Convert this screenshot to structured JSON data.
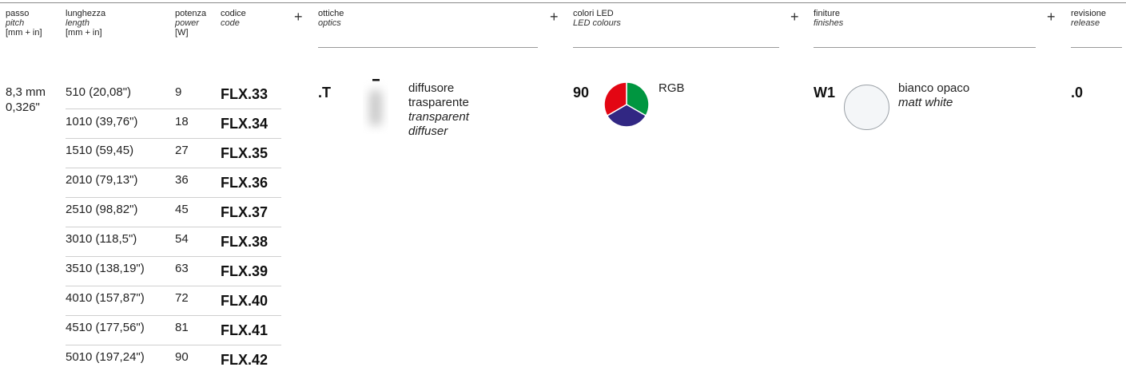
{
  "headers": {
    "pitch": {
      "it_label": "passo",
      "en_label": "pitch",
      "unit": "[mm + in]"
    },
    "length": {
      "it_label": "lunghezza",
      "en_label": "length",
      "unit": "[mm + in]"
    },
    "power": {
      "it_label": "potenza",
      "en_label": "power",
      "unit": "[W]"
    },
    "code": {
      "it_label": "codice",
      "en_label": "code"
    },
    "optics": {
      "it_label": "ottiche",
      "en_label": "optics"
    },
    "led": {
      "it_label": "colori LED",
      "en_label": "LED colours"
    },
    "finishes": {
      "it_label": "finiture",
      "en_label": "finishes"
    },
    "release": {
      "it_label": "revisione",
      "en_label": "release"
    }
  },
  "plus_symbol": "+",
  "pitch": {
    "mm": "8,3 mm",
    "in": "0,326\""
  },
  "rows": [
    {
      "length": "510 (20,08\")",
      "power": "9",
      "code": "FLX.33"
    },
    {
      "length": "1010 (39,76\")",
      "power": "18",
      "code": "FLX.34"
    },
    {
      "length": "1510 (59,45)",
      "power": "27",
      "code": "FLX.35"
    },
    {
      "length": "2010 (79,13\")",
      "power": "36",
      "code": "FLX.36"
    },
    {
      "length": "2510 (98,82\")",
      "power": "45",
      "code": "FLX.37"
    },
    {
      "length": "3010 (118,5\")",
      "power": "54",
      "code": "FLX.38"
    },
    {
      "length": "3510 (138,19\")",
      "power": "63",
      "code": "FLX.39"
    },
    {
      "length": "4010 (157,87\")",
      "power": "72",
      "code": "FLX.40"
    },
    {
      "length": "4510 (177,56\")",
      "power": "81",
      "code": "FLX.41"
    },
    {
      "length": "5010 (197,24\")",
      "power": "90",
      "code": "FLX.42"
    }
  ],
  "optics": {
    "code": ".T",
    "it_1": "diffusore",
    "it_2": "trasparente",
    "en_1": "transparent",
    "en_2": "diffuser"
  },
  "led": {
    "code": "90",
    "label": "RGB",
    "colors": {
      "red": "#e30613",
      "green": "#009640",
      "blue": "#312783"
    }
  },
  "finish": {
    "code": "W1",
    "it": "bianco opaco",
    "en": "matt white",
    "swatch": "#f4f6f8"
  },
  "release": {
    "code": ".0"
  }
}
